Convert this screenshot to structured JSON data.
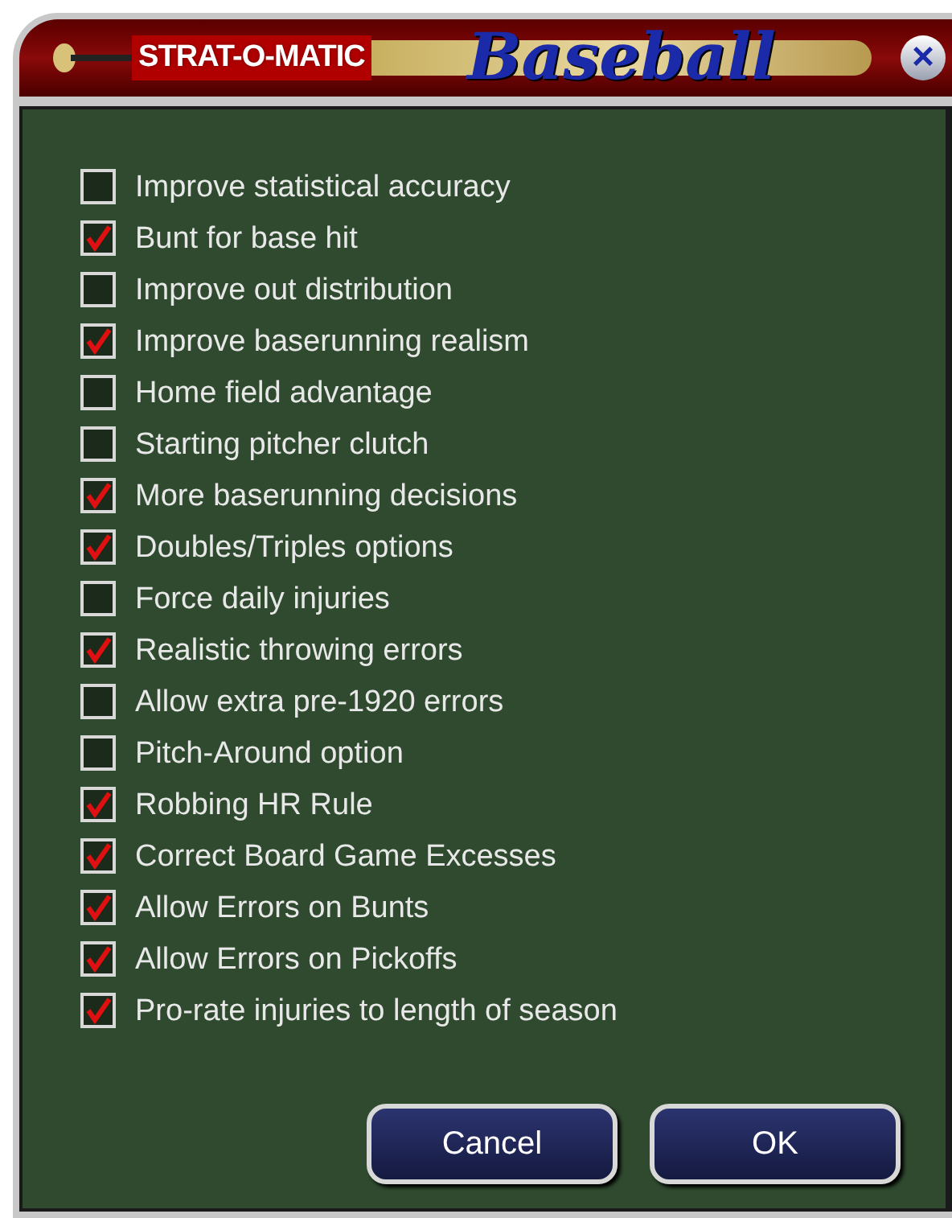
{
  "title_bar": {
    "brand": "STRAT-O-MATIC",
    "title": "Baseball",
    "close": "×"
  },
  "options": [
    {
      "label": "Improve statistical accuracy",
      "checked": false
    },
    {
      "label": "Bunt for base hit",
      "checked": true
    },
    {
      "label": "Improve out distribution",
      "checked": false
    },
    {
      "label": "Improve baserunning realism",
      "checked": true
    },
    {
      "label": "Home field advantage",
      "checked": false
    },
    {
      "label": "Starting pitcher clutch",
      "checked": false
    },
    {
      "label": "More baserunning decisions",
      "checked": true
    },
    {
      "label": "Doubles/Triples options",
      "checked": true
    },
    {
      "label": "Force daily injuries",
      "checked": false
    },
    {
      "label": "Realistic throwing errors",
      "checked": true
    },
    {
      "label": "Allow extra pre-1920 errors",
      "checked": false
    },
    {
      "label": "Pitch-Around option",
      "checked": false
    },
    {
      "label": "Robbing HR Rule",
      "checked": true
    },
    {
      "label": "Correct Board Game Excesses",
      "checked": true
    },
    {
      "label": "Allow Errors on Bunts",
      "checked": true
    },
    {
      "label": "Allow Errors on Pickoffs",
      "checked": true
    },
    {
      "label": "Pro-rate injuries to length of season",
      "checked": true
    }
  ],
  "buttons": [
    "Cancel",
    "OK"
  ]
}
